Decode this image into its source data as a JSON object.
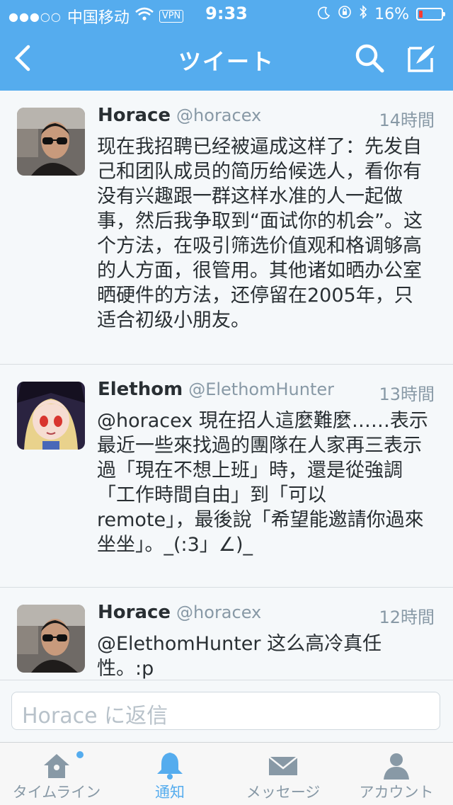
{
  "status_bar": {
    "carrier": "中国移动",
    "vpn": "VPN",
    "time": "9:33",
    "battery": "16%",
    "battery_level": 0.16
  },
  "nav": {
    "title": "ツイート",
    "back_icon": "chevron-left-icon",
    "search_icon": "search-icon",
    "compose_icon": "compose-icon"
  },
  "tweets": [
    {
      "name": "Horace",
      "handle": "@horacex",
      "time": "14時間",
      "text": "现在我招聘已经被逼成这样了：先发自\n己和团队成员的简历给候选人，看你有\n没有兴趣跟一群这样水准的人一起做\n事，然后我争取到“面试你的机会”。这\n个方法，在吸引筛选价值观和格调够高\n的人方面，很管用。其他诸如晒办公室\n晒硬件的方法，还停留在2005年，只\n适合初级小朋友。"
    },
    {
      "name": "Elethom",
      "handle": "@ElethomHunter",
      "time": "13時間",
      "text": "@horacex 現在招人這麼難麼……表示\n最近一些來找過的團隊在人家再三表示\n過「現在不想上班」時，還是從強調\n「工作時間自由」到「可以\nremote」，最後說「希望能邀請你過來\n坐坐」。_(:3」∠)_"
    },
    {
      "name": "Horace",
      "handle": "@horacex",
      "time": "12時間",
      "text": "@ElethomHunter 这么高冷真任性。:p"
    }
  ],
  "reply": {
    "placeholder": "Horace に返信"
  },
  "tabs": [
    {
      "label": "タイムライン",
      "icon": "home-icon"
    },
    {
      "label": "通知",
      "icon": "bell-icon"
    },
    {
      "label": "メッセージ",
      "icon": "envelope-icon"
    },
    {
      "label": "アカウント",
      "icon": "person-icon"
    }
  ],
  "colors": {
    "accent": "#55acee",
    "text": "#292f33",
    "secondary": "#8899a6"
  }
}
